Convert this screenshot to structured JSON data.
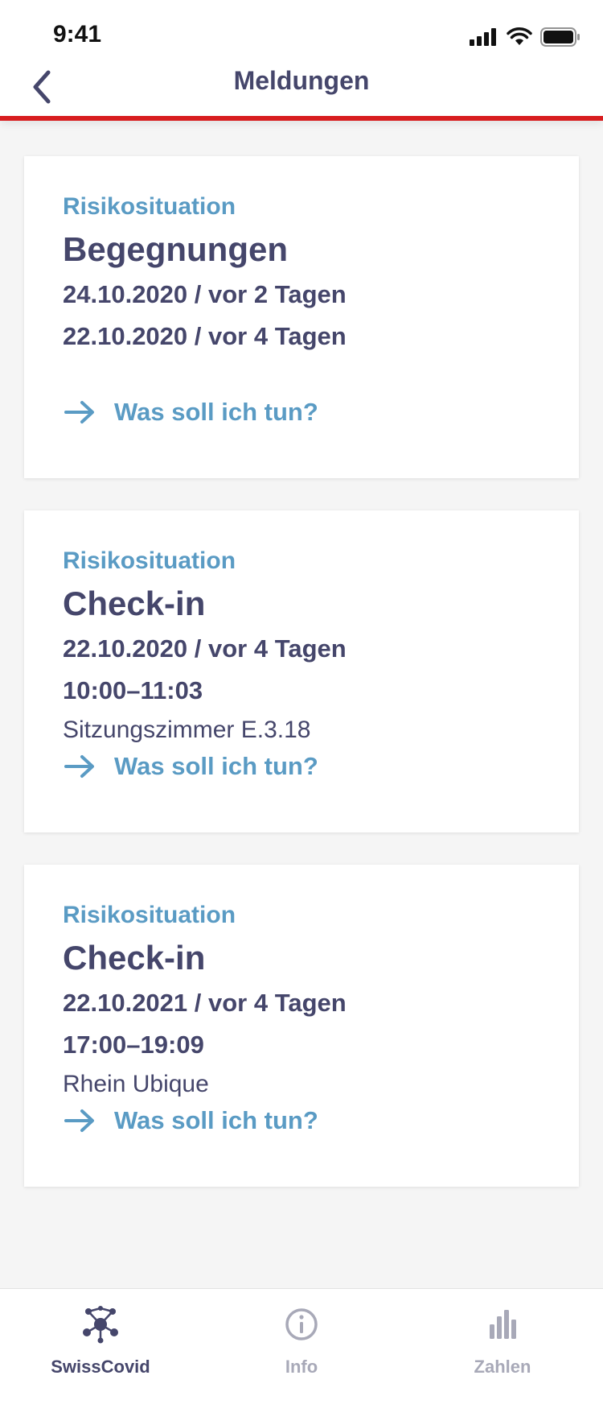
{
  "status_bar": {
    "time": "9:41"
  },
  "header": {
    "title": "Meldungen"
  },
  "cards": [
    {
      "label": "Risikosituation",
      "title": "Begegnungen",
      "lines": [
        "24.10.2020 / vor 2 Tagen",
        "22.10.2020 / vor 4 Tagen"
      ],
      "location": "",
      "link": "Was soll ich tun?"
    },
    {
      "label": "Risikosituation",
      "title": "Check-in",
      "lines": [
        "22.10.2020 / vor 4 Tagen",
        "10:00–11:03"
      ],
      "location": "Sitzungszimmer E.3.18",
      "link": "Was soll ich tun?"
    },
    {
      "label": "Risikosituation",
      "title": "Check-in",
      "lines": [
        "22.10.2021 / vor 4 Tagen",
        "17:00–19:09"
      ],
      "location": "Rhein Ubique",
      "link": "Was soll ich tun?"
    }
  ],
  "tabbar": {
    "tabs": [
      {
        "label": "SwissCovid",
        "icon": "swisscovid-icon",
        "active": true
      },
      {
        "label": "Info",
        "icon": "info-icon",
        "active": false
      },
      {
        "label": "Zahlen",
        "icon": "bar-chart-icon",
        "active": false
      }
    ]
  },
  "colors": {
    "accent_red": "#d81d1f",
    "link_blue": "#5a9bc4",
    "text_dark": "#45466b",
    "inactive": "#a8a9b8"
  }
}
